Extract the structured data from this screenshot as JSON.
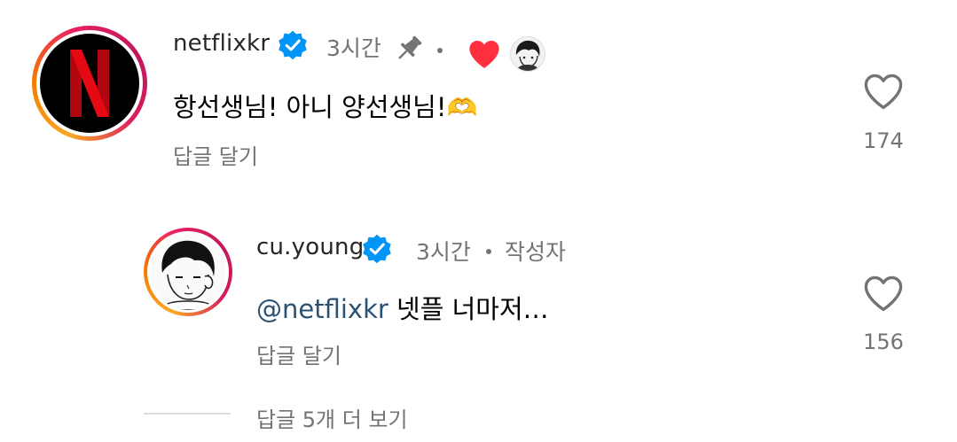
{
  "comments": [
    {
      "username": "netflixkr",
      "time": "3시간",
      "text": "항선생님! 아니 양선생님!",
      "emoji": "🫶",
      "reply_label": "답글 달기",
      "likes": "174",
      "pinned": true,
      "liked_by_creator": true
    },
    {
      "username": "cu.young",
      "time": "3시간",
      "author_label": "작성자",
      "mention": "@netflixkr",
      "text": " 넷플 너마저…",
      "reply_label": "답글 달기",
      "likes": "156"
    }
  ],
  "view_replies": "답글 5개 더 보기",
  "colors": {
    "verified": "#0095f6",
    "heart_red": "#ff3040",
    "netflix_red": "#e50914",
    "mention": "#2b5275",
    "muted": "#737373"
  },
  "icons": [
    "verified-badge-icon",
    "pin-icon",
    "heart-filled-icon",
    "heart-outline-icon"
  ]
}
